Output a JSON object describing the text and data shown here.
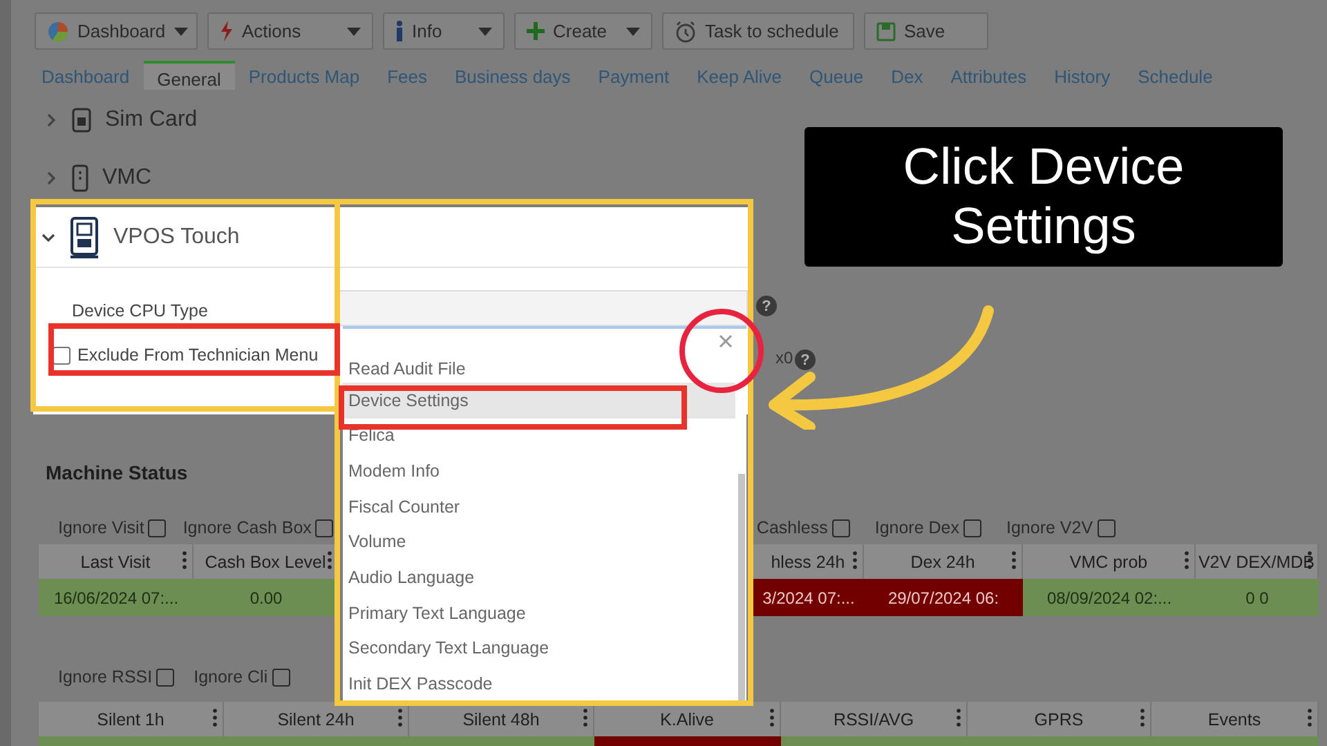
{
  "toolbar": [
    {
      "label": "Dashboard",
      "dropdown": true
    },
    {
      "label": "Actions",
      "dropdown": true
    },
    {
      "label": "Info",
      "dropdown": true
    },
    {
      "label": "Create",
      "dropdown": true
    },
    {
      "label": "Task to schedule",
      "dropdown": false
    },
    {
      "label": "Save",
      "dropdown": false
    }
  ],
  "tabs": [
    {
      "label": "Dashboard",
      "selected": false
    },
    {
      "label": "General",
      "selected": true
    },
    {
      "label": "Products Map",
      "selected": false
    },
    {
      "label": "Fees",
      "selected": false
    },
    {
      "label": "Business days",
      "selected": false
    },
    {
      "label": "Payment",
      "selected": false
    },
    {
      "label": "Keep Alive",
      "selected": false
    },
    {
      "label": "Queue",
      "selected": false
    },
    {
      "label": "Dex",
      "selected": false
    },
    {
      "label": "Attributes",
      "selected": false
    },
    {
      "label": "History",
      "selected": false
    },
    {
      "label": "Schedule",
      "selected": false
    }
  ],
  "sections": [
    {
      "title": "Sim Card",
      "expanded": false
    },
    {
      "title": "VMC",
      "expanded": false
    }
  ],
  "vpos": {
    "title": "VPOS Touch",
    "expanded": true,
    "fields": [
      {
        "kind": "select",
        "label": "Device CPU Type",
        "help": "?"
      },
      {
        "kind": "checkbox",
        "label": "Exclude From Technician Menu",
        "checked": false,
        "suffix": "x0",
        "help": "?"
      }
    ]
  },
  "dropdown": {
    "options": [
      {
        "label": "Read Audit File",
        "selected": false
      },
      {
        "label": "Device Settings",
        "selected": true
      },
      {
        "label": "Felica",
        "selected": false
      },
      {
        "label": "Modem Info",
        "selected": false
      },
      {
        "label": "Fiscal Counter",
        "selected": false
      },
      {
        "label": "Volume",
        "selected": false
      },
      {
        "label": "Audio Language",
        "selected": false
      },
      {
        "label": "Primary Text Language",
        "selected": false
      },
      {
        "label": "Secondary Text Language",
        "selected": false
      },
      {
        "label": "Init DEX Passcode",
        "selected": false
      }
    ]
  },
  "machine_status": {
    "title": "Machine Status",
    "filters_1": [
      {
        "label": "Ignore Visit",
        "checked": false
      },
      {
        "label": "Ignore Cash Box",
        "checked": false
      },
      {
        "label": "Cashless",
        "checked": false
      },
      {
        "label": "Ignore Dex",
        "checked": false
      },
      {
        "label": "Ignore V2V",
        "checked": false
      }
    ],
    "table_1": {
      "columns": [
        "Last Visit",
        "Cash Box Level",
        "hless 24h",
        "Dex 24h",
        "VMC prob",
        "V2V DEX/MDB"
      ],
      "rows": [
        [
          {
            "text": "16/06/2024 07:...",
            "color": "#6d8e52"
          },
          {
            "text": "0.00",
            "color": "#6d8e52"
          },
          {
            "text": "3/2024 07:...",
            "color": "#720000"
          },
          {
            "text": "29/07/2024 06:",
            "color": "#720000"
          },
          {
            "text": "08/09/2024 02:...",
            "color": "#6d8e52"
          },
          {
            "text": "0 0",
            "color": "#6d8e52"
          }
        ]
      ]
    },
    "filters_2": [
      {
        "label": "Ignore RSSI",
        "checked": false
      },
      {
        "label": "Ignore Cli",
        "checked": false
      }
    ],
    "table_2": {
      "columns": [
        "Silent 1h",
        "Silent 24h",
        "Silent 48h",
        "K.Alive",
        "RSSI/AVG",
        "GPRS",
        "Events"
      ],
      "rows": [
        [
          {
            "color": "#6d8e52"
          },
          {
            "color": "#6d8e52"
          },
          {
            "color": "#6d8e52"
          },
          {
            "color": "#720000"
          },
          {
            "color": "#6d8e52"
          },
          {
            "color": "#6d8e52"
          },
          {
            "color": "#6d8e52"
          }
        ]
      ]
    }
  },
  "callout": {
    "text": "Click Device Settings"
  }
}
